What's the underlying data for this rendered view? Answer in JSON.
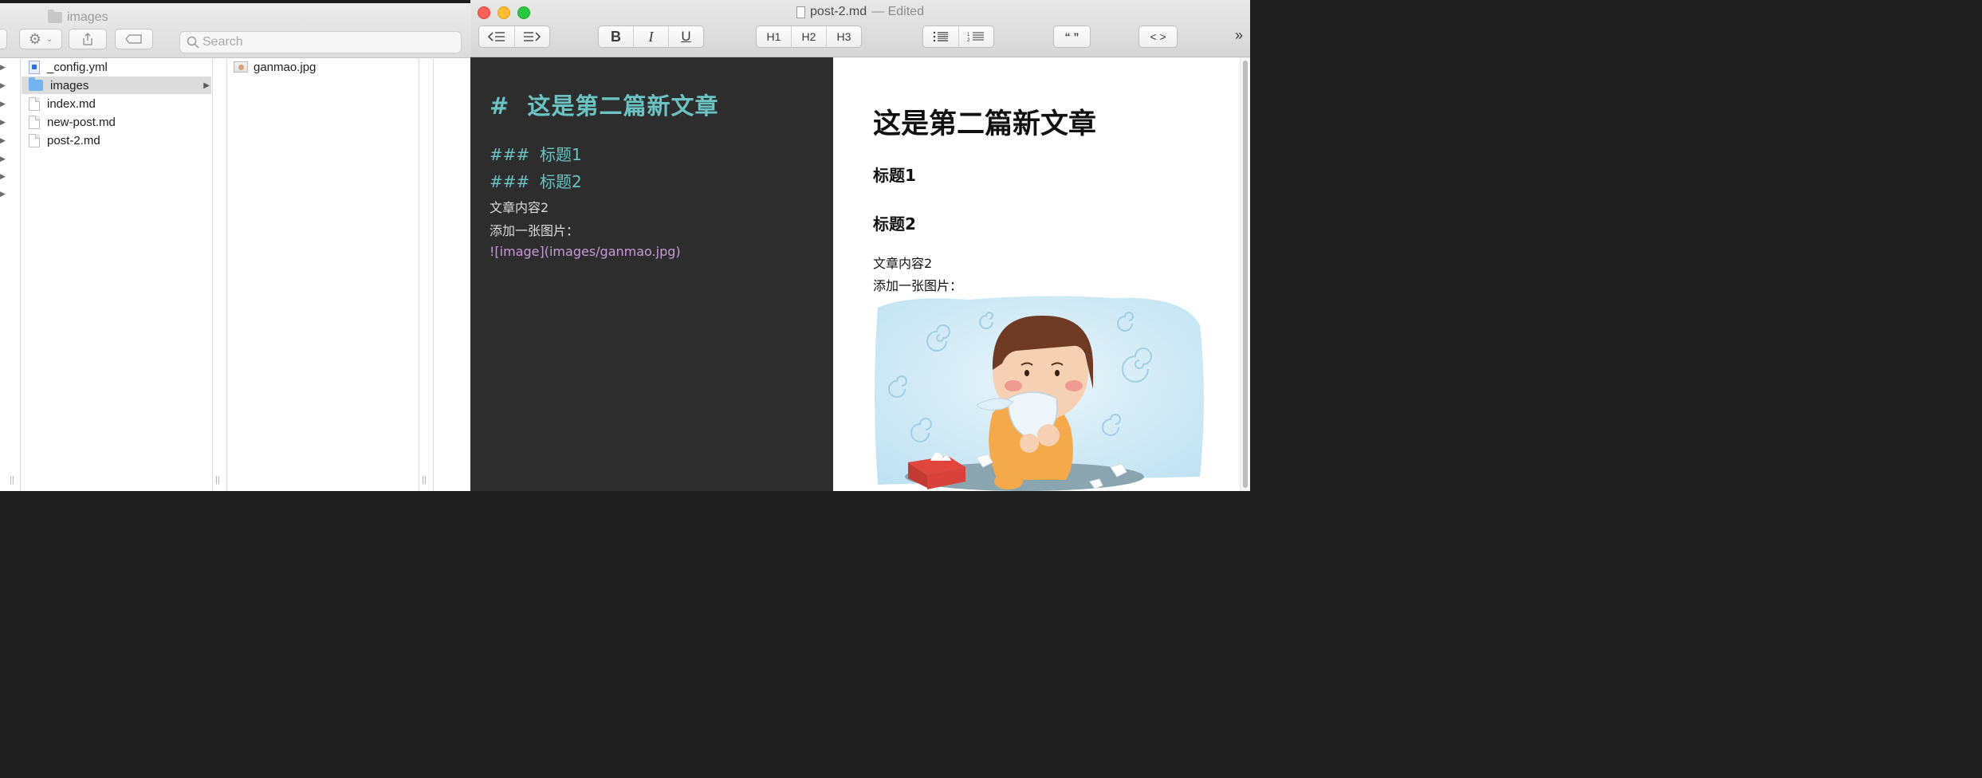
{
  "finder": {
    "title": "images",
    "search_placeholder": "Search",
    "files": [
      {
        "name": "_config.yml",
        "type": "yml"
      },
      {
        "name": "images",
        "type": "folder",
        "selected": true
      },
      {
        "name": "index.md",
        "type": "doc"
      },
      {
        "name": "new-post.md",
        "type": "doc"
      },
      {
        "name": "post-2.md",
        "type": "doc"
      }
    ],
    "images_folder": [
      {
        "name": "ganmao.jpg"
      }
    ]
  },
  "editor": {
    "filename": "post-2.md",
    "status": "— Edited",
    "toolbar": {
      "bold": "B",
      "italic": "I",
      "underline": "U",
      "h1": "H1",
      "h2": "H2",
      "h3": "H3",
      "quote": "“ ”",
      "code": "< >",
      "more": "»"
    },
    "markdown": {
      "h1_marker": "#",
      "h1_text": "这是第二篇新文章",
      "h3_marker": "###",
      "h3a_text": "标题1",
      "h3b_text": "标题2",
      "line1": "文章内容2",
      "line2": "添加一张图片：",
      "image_line": "![image](images/ganmao.jpg)"
    },
    "preview": {
      "h1": "这是第二篇新文章",
      "h3a": "标题1",
      "h3b": "标题2",
      "line1": "文章内容2",
      "line2": "添加一张图片："
    }
  },
  "colors": {
    "md_heading": "#6cc3c3",
    "md_link": "#c79bd6",
    "md_bg": "#2d2d2d",
    "close": "#fe5f57",
    "minimize": "#febc2e",
    "zoom": "#28c840"
  }
}
